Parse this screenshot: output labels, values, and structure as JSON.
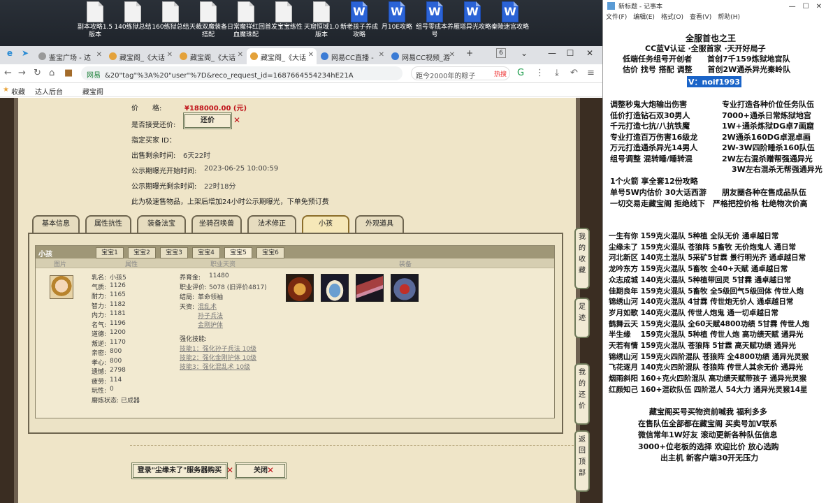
{
  "desktop": {
    "icons": [
      {
        "label": "副本攻略1.5版本",
        "type": "doc"
      },
      {
        "label": "140练狱总结",
        "type": "doc"
      },
      {
        "label": "160练狱总结",
        "type": "doc"
      },
      {
        "label": "天裁双魔装备搭配",
        "type": "doc"
      },
      {
        "label": "日常魔祥红回血魔珠配",
        "type": "doc"
      },
      {
        "label": "首发宝宝练性",
        "type": "doc"
      },
      {
        "label": "天窟恒域1.0版本",
        "type": "doc"
      },
      {
        "label": "新老孩子养成攻略",
        "type": "word"
      },
      {
        "label": "月10E攻略",
        "type": "word"
      },
      {
        "label": "组号零成本养号",
        "type": "word"
      },
      {
        "label": "雁塔异光攻略",
        "type": "word"
      },
      {
        "label": "秦陵迷宫攻略",
        "type": "word"
      }
    ]
  },
  "browser": {
    "tabs": [
      {
        "label": "鉴宝广场 - 达"
      },
      {
        "label": "藏宝阁_《大话"
      },
      {
        "label": "藏宝阁_《大话"
      },
      {
        "label": "藏宝阁_《大话",
        "active": true
      },
      {
        "label": "网易CC直播 -"
      },
      {
        "label": "网易CC视频_游"
      }
    ],
    "tab_count": "6",
    "url_site": "网易",
    "url": "&20\"tag\"%3A%20\"user\"%7D&reco_request_id=1687664554234hE21A",
    "search_text": "距今2000年的粽子",
    "search_hot": "热搜",
    "bookmarks": {
      "fav": "收藏",
      "b1": "达人后台",
      "b2": "藏宝阁"
    }
  },
  "game": {
    "price_label": "价　　格:",
    "price_value": "¥188000.00 (元)",
    "accept_counter_label": "是否接受还价:",
    "counter_button": "还价",
    "buyer_label": "指定买家 ID：",
    "remaining_label": "出售剩余时间:",
    "remaining_value": "6天22时",
    "public_start_label": "公示期曝光开始时间:",
    "public_start_value": "2023-06-25 10:00:59",
    "public_remaining_label": "公示期曝光剩余时间:",
    "public_remaining_value": "22时18分",
    "notice": "此为极速售物品，上架后增加24小时公示期曝光，下单免预订费",
    "tabs": [
      {
        "label": "基本信息"
      },
      {
        "label": "属性抗性"
      },
      {
        "label": "装备法宝"
      },
      {
        "label": "坐骑召唤兽"
      },
      {
        "label": "法术修正"
      },
      {
        "label": "小孩",
        "active": true
      },
      {
        "label": "外观道具"
      }
    ],
    "child_panel_title": "小孩",
    "baby_tabs": [
      "宝宝1",
      "宝宝2",
      "宝宝3",
      "宝宝4",
      "宝宝5",
      "宝宝6"
    ],
    "active_baby": "宝宝5",
    "columns": {
      "pic": "图片",
      "attr": "属性",
      "career": "职业天资",
      "equip": "装备"
    },
    "attrs": [
      {
        "label": "乳名:",
        "value": "小孩5"
      },
      {
        "label": "气质:",
        "value": "1126"
      },
      {
        "label": "耐力:",
        "value": "1165"
      },
      {
        "label": "智力:",
        "value": "1182"
      },
      {
        "label": "内力:",
        "value": "1181"
      },
      {
        "label": "名气:",
        "value": "1196"
      },
      {
        "label": "道德:",
        "value": "1200"
      },
      {
        "label": "叛逆:",
        "value": "1170"
      },
      {
        "label": "亲密:",
        "value": "800"
      },
      {
        "label": "孝心:",
        "value": "800"
      },
      {
        "label": "遗憾:",
        "value": "2798"
      },
      {
        "label": "疲劳:",
        "value": "114"
      },
      {
        "label": "玩性:",
        "value": "0"
      },
      {
        "label": "磨炼状态:",
        "value": "已成器"
      }
    ],
    "career": {
      "raise_label": "养育金:",
      "raise_value": "11480",
      "eval_label": "职业评价:",
      "eval_value": "5078 (旧评价4817)",
      "ending_label": "结局:",
      "ending_value": "革命领袖",
      "talent_label": "天资:",
      "talents": [
        "混乱术",
        "孙子兵法",
        "金刚护体"
      ],
      "skill_label": "强化技能:",
      "skills": [
        "技能1：强化孙子兵法 10级",
        "技能2：强化金刚护体 10级",
        "技能3：强化混乱术 10级"
      ]
    },
    "login_button": "登录\"尘缘未了\"服务器购买",
    "close_button": "关闭",
    "side_buttons": [
      "我的收藏",
      "足迹",
      "我的还价",
      "返回顶部"
    ]
  },
  "notepad": {
    "title": "新标题 - 记事本",
    "menu": [
      "文件(F)",
      "编辑(E)",
      "格式(O)",
      "查看(V)",
      "帮助(H)"
    ],
    "header_lines": [
      "全服首也之王",
      "CC蓝V认证 ·全服首家 ·天开好局子",
      "低端任务组号开创者　　首创7千159炼狱地宫队",
      "估价 找号 搭配 调整　　首创2W通杀异光秦岭队"
    ],
    "contact": "V：noif1993",
    "service_lines": [
      [
        "调整秒鬼大炮输出伤害",
        "专业打造各种价位任务队伍"
      ],
      [
        "低价打造钻石双30男人",
        "7000+通杀日常炼狱地宫"
      ],
      [
        "千元打造七抗/八抗铁魔",
        "1W+通杀炼狱DG卓7画窟"
      ],
      [
        "专业打造百万伤害16级龙",
        "2W通杀160DG卓混卓画"
      ],
      [
        "万元打造通杀异光14男人",
        "2W-3W四阶睡杀160队伍"
      ],
      [
        "组号调整 混转睡/睡转混",
        "2W左右混杀赠帮强通异光"
      ],
      [
        "",
        "3W左右混杀无帮强通异光"
      ]
    ],
    "offer_lines": [
      "1个火箭 享全套12份攻略",
      "单号5W内估价 30大话西游　　朋友圈各种在售成品队伍",
      "一切交易走藏宝阁 拒绝线下　严格把控价格 杜绝物次价高"
    ],
    "listing_lines": [
      "一生有你 159克火混队 5种植 全队无价 通卓越日常",
      "尘缘未了 159克火混队 苍狼阵 5畜牧 无价炮鬼人 通日常",
      "河北新区 140克土混队 5采矿5甘霖 景行明光齐 通卓越日常",
      "龙吟东方 159克火混队 5畜牧 全40+天赋 通卓越日常",
      "众志成城 140克火混队 5种植带回灵 5甘霖 通卓越日常",
      "佳期良年 159克火混队 5畜牧 全5级回气5级回体 传世人炮",
      "锦绣山河 140克火混队 4甘霖 传世炮无价人 通卓越日常",
      "岁月如歌 140克火混队 传世人炮鬼 通一切卓越日常",
      "鹤舞云天 159克火混队 全60天赋4800功绩 5甘霖 传世人炮",
      "半生缘　 159克火混队 5种植 传世人炮 高功绩天赋 通异光",
      "天若有情 159克火混队 苍狼阵 5甘霖 高天赋功绩 通异光",
      "锦绣山河 159克火四阶混队 苍狼阵 全4800功绩 通异光灵猴",
      "飞花逐月 140克火四阶混队 苍狼阵 传世人其余无价 通异光",
      "烟雨斜阳 160+克火四阶混队 高功绩天赋带孩子 通异光灵猴",
      "红颜知己 160+混砍队伍 四阶混人 54大力 通异光灵猴14星"
    ],
    "footer_lines": [
      "藏宝阁买号买物资前喊我 福利多多",
      "在售队伍全部都在藏宝阁 买卖号加V联系",
      "微信常年1W好友 滚动更新各种队伍信息",
      "3000+位老板的选择 欢迎比价 放心选购",
      "出主机 新客户端30开无压力"
    ]
  }
}
